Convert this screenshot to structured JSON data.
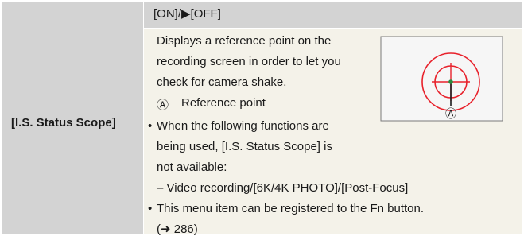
{
  "row": {
    "label": "[I.S. Status Scope]",
    "options": "[ON]/▶[OFF]",
    "description": [
      "Displays a reference point on the",
      "recording screen in order to let you",
      "check for camera shake."
    ],
    "reference": {
      "marker": "Ⓐ",
      "text": "Reference point"
    },
    "bullet1": [
      "When the following functions are",
      "being used, [I.S. Status Scope] is",
      "not available:"
    ],
    "dash_item": "– Video recording/[6K/4K PHOTO]/[Post-Focus]",
    "bullet2": "This menu item can be registered to the Fn button.",
    "page_ref": "(➜ 286)",
    "bullet_char": "•"
  },
  "figure": {
    "callout": "Ⓐ",
    "colors": {
      "circle": "#e8212b",
      "dot": "#2b8a3e",
      "frame": "#7a7a7a"
    }
  }
}
